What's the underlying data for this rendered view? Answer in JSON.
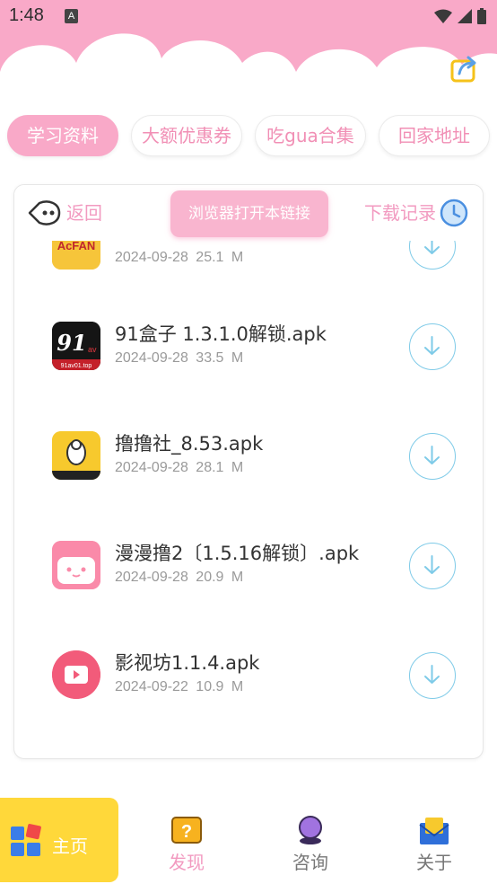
{
  "status_bar": {
    "time": "1:48",
    "a_badge": "A"
  },
  "tabs": [
    {
      "label": "学习资料",
      "active": true
    },
    {
      "label": "大额优惠券",
      "active": false
    },
    {
      "label": "吃gua合集",
      "active": false
    },
    {
      "label": "回家地址",
      "active": false
    }
  ],
  "toolbar": {
    "back_label": "返回",
    "open_browser_label": "浏览器打开本链接",
    "downloads_label": "下载记录"
  },
  "files": [
    {
      "name": "",
      "date": "2024-09-28",
      "size": "25.1 M",
      "icon": "acfun-icon"
    },
    {
      "name": "91盒子 1.3.1.0解锁.apk",
      "date": "2024-09-28",
      "size": "33.5 M",
      "icon": "91-box-icon"
    },
    {
      "name": "撸撸社_8.53.apk",
      "date": "2024-09-28",
      "size": "28.1 M",
      "icon": "lulushe-icon"
    },
    {
      "name": "漫漫撸2〔1.5.16解锁〕.apk",
      "date": "2024-09-28",
      "size": "20.9 M",
      "icon": "manmanlu-icon"
    },
    {
      "name": "影视坊1.1.4.apk",
      "date": "2024-09-22",
      "size": "10.9 M",
      "icon": "video-play-icon"
    }
  ],
  "bottom_nav": {
    "home": "主页",
    "discover": "发现",
    "consult": "咨询",
    "about": "关于"
  },
  "colors": {
    "pink": "#f9a9c8",
    "pink_text": "#f18fb5",
    "blue": "#7fcbe8",
    "yellow": "#ffd83a"
  }
}
